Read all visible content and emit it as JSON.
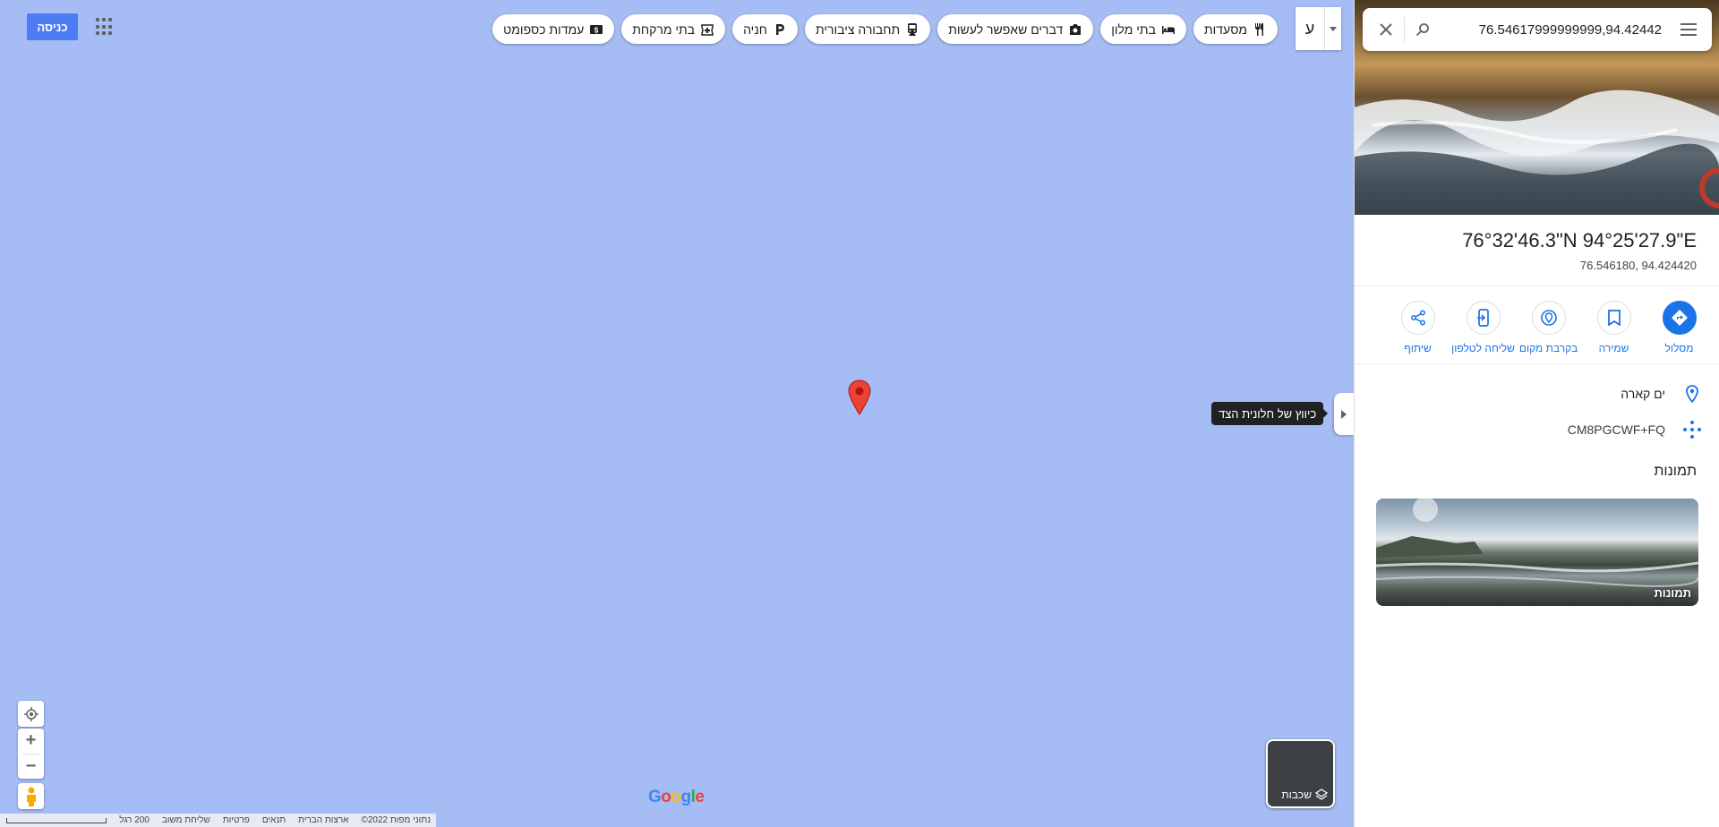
{
  "search": {
    "query": "76.54617999999999,94.42442"
  },
  "header": {
    "signin_label": "כניסה",
    "lang_char": "ע",
    "chips": [
      {
        "label": "מסעדות",
        "icon": "fork-knife-icon"
      },
      {
        "label": "בתי מלון",
        "icon": "bed-icon"
      },
      {
        "label": "דברים שאפשר לעשות",
        "icon": "camera-icon"
      },
      {
        "label": "תחבורה ציבורית",
        "icon": "train-icon"
      },
      {
        "label": "חניה",
        "icon": "parking-icon"
      },
      {
        "label": "בתי מרקחת",
        "icon": "pharmacy-icon"
      },
      {
        "label": "עמדות כספומט",
        "icon": "atm-icon"
      }
    ]
  },
  "map": {
    "collapse_tooltip": "כיווץ של חלונית הצד",
    "layers_label": "שכבות",
    "logo_text": "Google",
    "footer": {
      "scale_label": "200 רגל",
      "links": [
        "נתוני מפות ‎©2022",
        "ארצות הברית",
        "תנאים",
        "פרטיות",
        "שליחת משוב"
      ]
    }
  },
  "place": {
    "coords_dms": "76°32'46.3\"N 94°25'27.9\"E",
    "coords_decimal": "76.546180, 94.424420",
    "actions": [
      {
        "label": "מסלול",
        "icon": "directions-icon"
      },
      {
        "label": "שמירה",
        "icon": "bookmark-icon"
      },
      {
        "label": "בקרבת מקום",
        "icon": "nearby-icon"
      },
      {
        "label": "שליחה לטלפון",
        "icon": "send-to-phone-icon"
      },
      {
        "label": "שיתוף",
        "icon": "share-icon"
      }
    ],
    "location_name": "ים קארה",
    "plus_code": "CM8PGCWF+FQ",
    "photos_heading": "תמונות",
    "photos_card_label": "תמונות"
  },
  "colors": {
    "accent": "#1a73e8",
    "map_water": "#a6bcf5",
    "pin": "#ea4335",
    "signin": "#4e7cf5"
  }
}
